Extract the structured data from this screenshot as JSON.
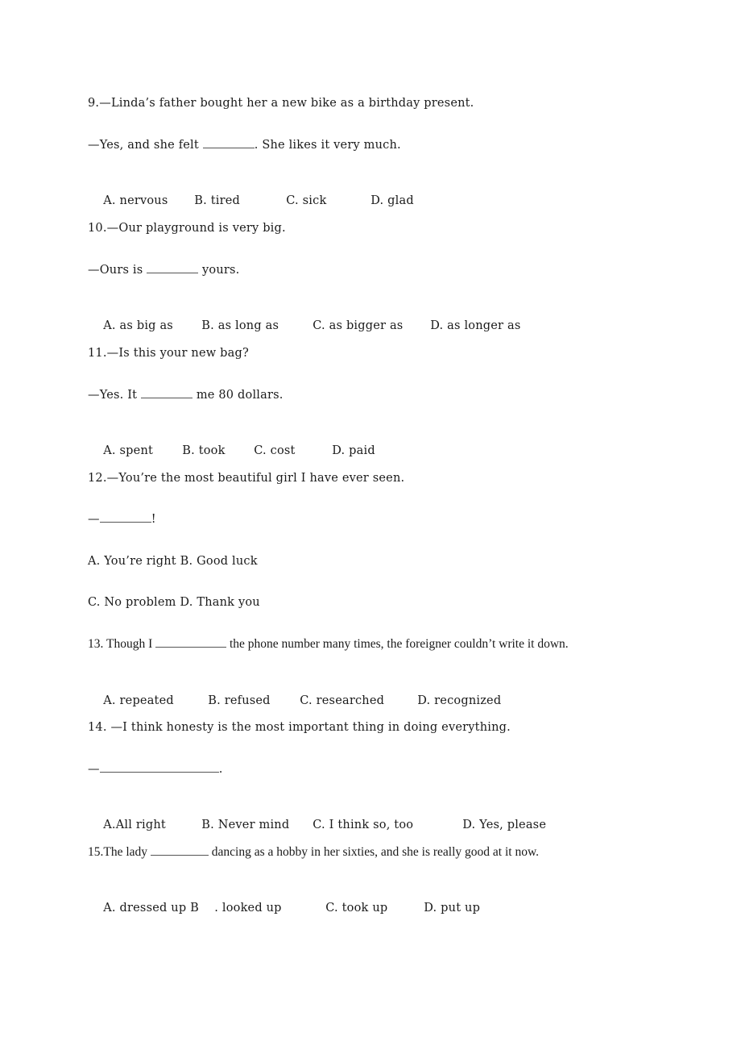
{
  "questions": [
    {
      "number": "9.",
      "prompt": "—Linda’s father bought her a new bike as a birthday present.",
      "response_before": "—Yes, and she felt ",
      "response_after": ". She likes it very much.",
      "options": [
        "A. nervous",
        "B. tired",
        "C. sick",
        "D. glad"
      ]
    },
    {
      "number": "10.",
      "prompt": "—Our playground is very big.",
      "response_before": "—Ours is ",
      "response_after": " yours.",
      "options": [
        "A. as big as",
        "B. as long as",
        "C. as bigger as",
        "D. as longer as"
      ]
    },
    {
      "number": "11.",
      "prompt": "—Is this your new bag?",
      "response_before": "—Yes. It ",
      "response_after": " me 80 dollars.",
      "options": [
        "A. spent",
        "B. took",
        "C. cost",
        "D. paid"
      ]
    },
    {
      "number": "12.",
      "prompt": "—You’re the most beautiful girl I have ever seen.",
      "response_before": "—",
      "response_after": "!",
      "options_line1": "A. You’re right B. Good luck",
      "options_line2": "C. No problem D. Thank you"
    },
    {
      "number": "13.",
      "prompt_before": " Though I ",
      "prompt_after": " the phone number many times, the foreigner couldn’t write it down.",
      "options": [
        "A. repeated",
        "B. refused",
        "C. researched",
        "D. recognized"
      ]
    },
    {
      "number": "14.",
      "prompt": " —I think honesty is the most important thing in doing everything.",
      "response_before": "—",
      "response_after": ".",
      "options": [
        "A.All right",
        "B. Never mind",
        "C. I think so, too",
        "D. Yes, please"
      ]
    },
    {
      "number": "15.",
      "prompt_before": "The lady ",
      "prompt_after": " dancing as a hobby in her sixties, and she is really good at it now.",
      "options": [
        "A. dressed up B",
        ". looked up",
        "C. took up",
        "D. put up"
      ]
    }
  ]
}
